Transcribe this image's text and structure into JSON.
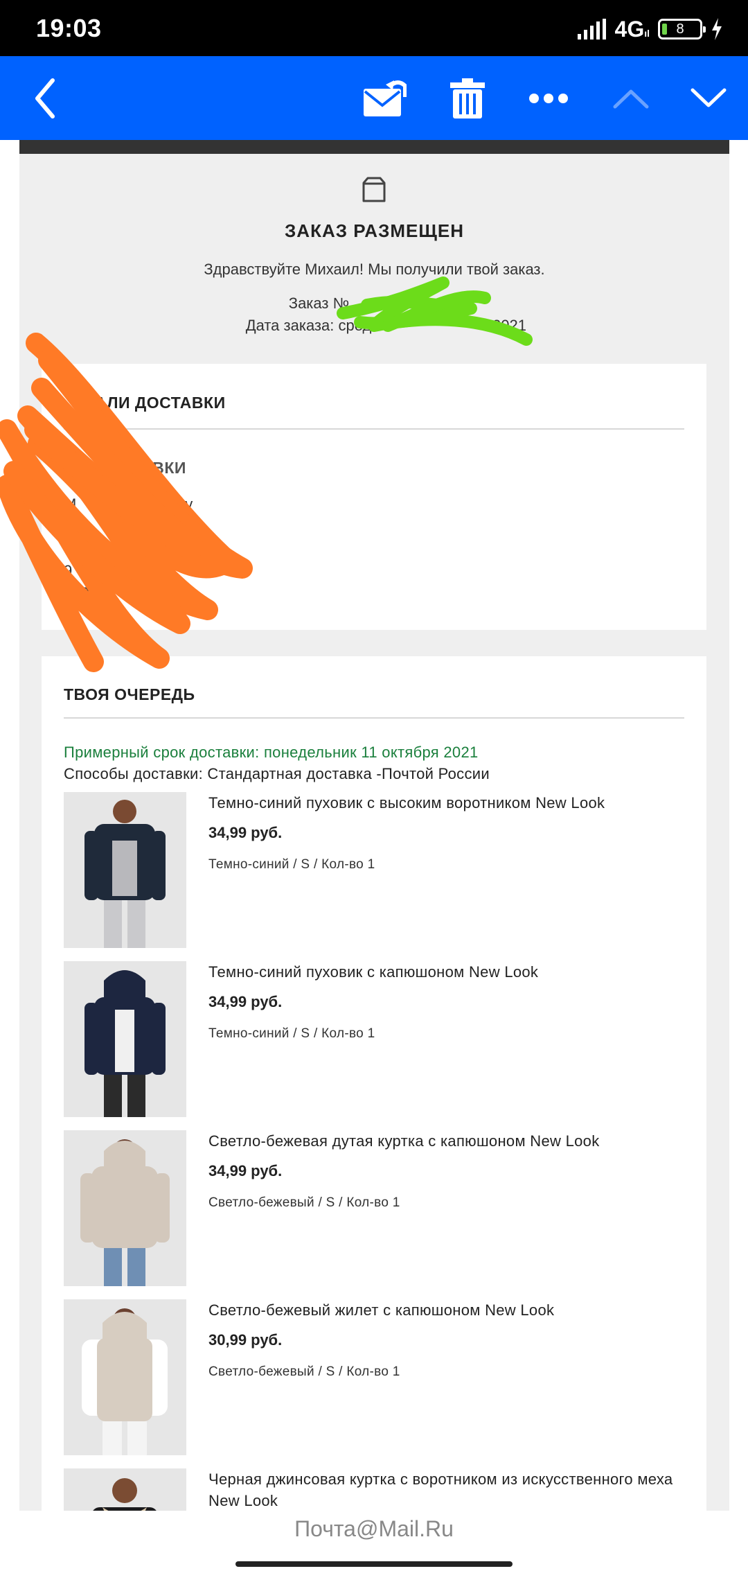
{
  "status_bar": {
    "time": "19:03",
    "network": "4G",
    "network_sub": "ıl",
    "battery": "8"
  },
  "toolbar": {
    "back_icon": "chevron-left-icon",
    "reply_icon": "mail-reply-icon",
    "delete_icon": "trash-icon",
    "more_icon": "more-dots-icon",
    "prev_icon": "chevron-up-icon",
    "next_icon": "chevron-down-icon"
  },
  "colors": {
    "toolbar": "#0062ff",
    "estimate": "#1a7f3c",
    "frame": "#efefef"
  },
  "order_header": {
    "icon": "package-icon",
    "title": "ЗАКАЗ РАЗМЕЩЕН",
    "greeting": "Здравствуйте Михаил! Мы получили твой заказ.",
    "order_number": "Заказ №",
    "order_date": "Дата заказа: сред",
    "order_date_end": "2021"
  },
  "delivery_card": {
    "title": "ЕТАЛИ ДОСТАВКИ",
    "subtitle": "ТАВКИ",
    "name_fragment": "M",
    "name_end": "ov",
    "line2": "t.",
    "line3": "3",
    "line4": "9",
    "line5": "980"
  },
  "queue_card": {
    "title": "ТВОЯ ОЧЕРЕДЬ",
    "estimate": "Примерный срок доставки: понедельник 11 октября 2021",
    "method": "Способы доставки: Стандартная доставка -Почтой России"
  },
  "items": [
    {
      "name": "Темно-синий пуховик с высоким воротником New Look",
      "price": "34,99 руб.",
      "meta": "Темно-синий / S / Кол-во 1"
    },
    {
      "name": "Темно-синий пуховик с капюшоном New Look",
      "price": "34,99 руб.",
      "meta": "Темно-синий / S / Кол-во 1"
    },
    {
      "name": "Светло-бежевая дутая куртка с капюшоном New Look",
      "price": "34,99 руб.",
      "meta": "Светло-бежевый / S / Кол-во 1"
    },
    {
      "name": "Светло-бежевый жилет с капюшоном New Look",
      "price": "30,99 руб.",
      "meta": "Светло-бежевый / S / Кол-во 1"
    },
    {
      "name": "Черная джинсовая куртка с воротником из искусственного меха New Look",
      "price": "",
      "meta": ""
    }
  ],
  "footer": {
    "brand": "Почта@Mail.Ru"
  }
}
